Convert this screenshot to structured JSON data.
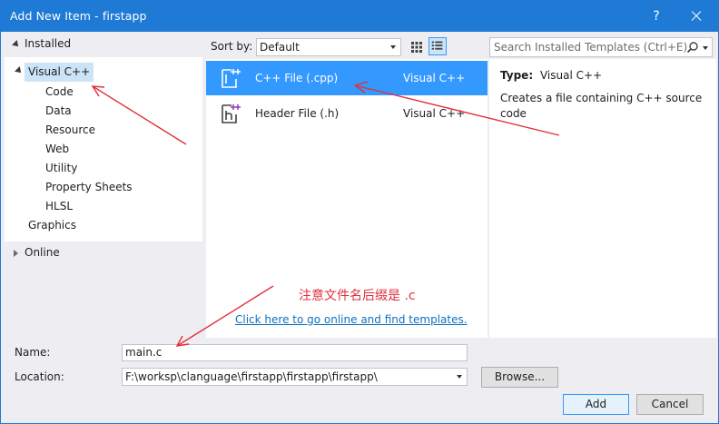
{
  "window": {
    "title": "Add New Item - firstapp",
    "help_label": "?"
  },
  "tree": {
    "installed_label": "Installed",
    "root_label": "Visual C++",
    "children": [
      "Code",
      "Data",
      "Resource",
      "Web",
      "Utility",
      "Property Sheets",
      "HLSL"
    ],
    "graphics_label": "Graphics",
    "online_label": "Online"
  },
  "toolbar": {
    "sort_label": "Sort by:",
    "sort_value": "Default"
  },
  "search": {
    "placeholder": "Search Installed Templates (Ctrl+E)"
  },
  "templates": [
    {
      "name": "C++ File (.cpp)",
      "language": "Visual C++",
      "selected": true
    },
    {
      "name": "Header File (.h)",
      "language": "Visual C++",
      "selected": false
    }
  ],
  "info": {
    "type_label": "Type:",
    "type_value": "Visual C++",
    "description": "Creates a file containing C++ source code"
  },
  "annotation": {
    "note": "注意文件名后缀是 .c",
    "arrow_color": "#e0303a"
  },
  "online_link": "Click here to go online and find templates.",
  "form": {
    "name_label": "Name:",
    "name_value": "main.c",
    "location_label": "Location:",
    "location_value": "F:\\worksp\\clanguage\\firstapp\\firstapp\\firstapp\\",
    "browse_label": "Browse...",
    "add_label": "Add",
    "cancel_label": "Cancel"
  },
  "colors": {
    "accent": "#1f7ad6",
    "selection": "#3399ff",
    "tree_selection": "#cce4f7",
    "link": "#0e70c0"
  }
}
